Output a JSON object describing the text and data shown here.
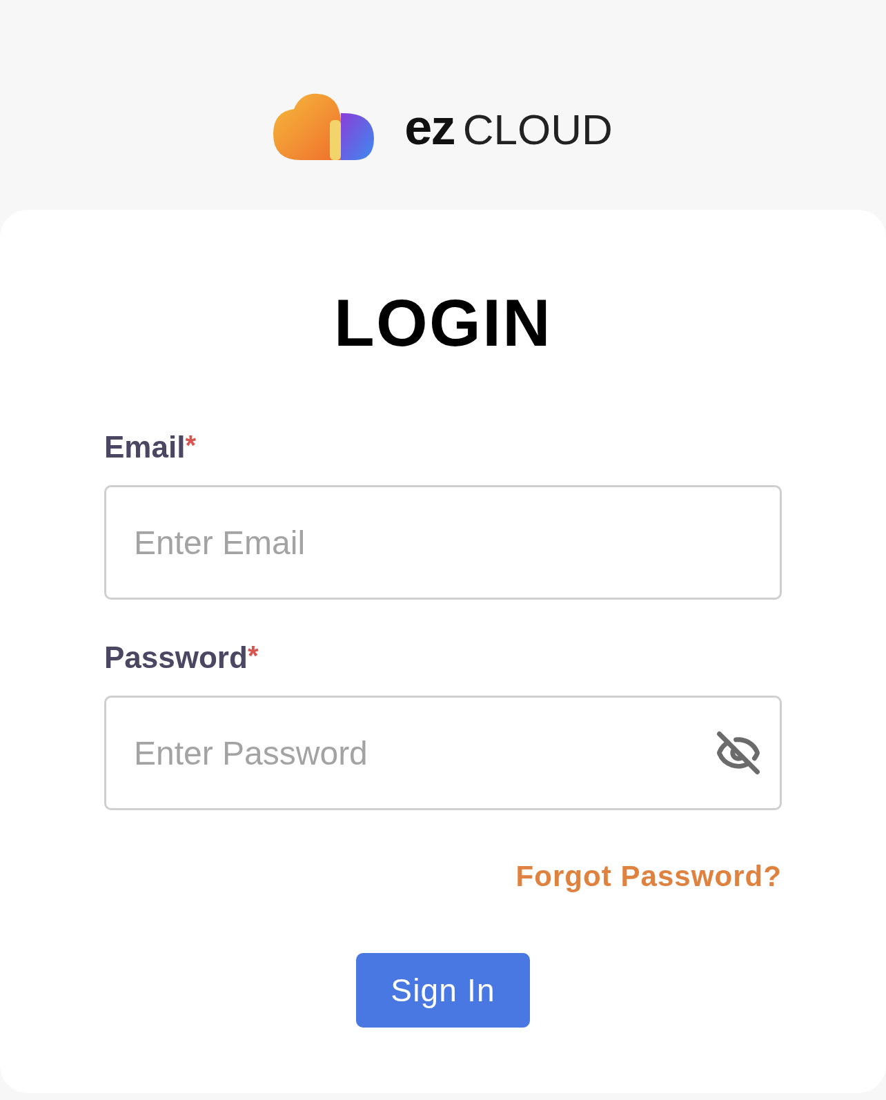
{
  "logo": {
    "mark": "ez",
    "wordmark": "CLOUD"
  },
  "login": {
    "title": "LOGIN",
    "fields": [
      {
        "label": "Email",
        "required_mark": "*",
        "placeholder": "Enter Email",
        "kind": "text"
      },
      {
        "label": "Password",
        "required_mark": "*",
        "placeholder": "Enter Password",
        "kind": "password",
        "password_visible": false
      }
    ],
    "forgot_link": "Forgot Password?",
    "submit_button": "Sign In"
  }
}
